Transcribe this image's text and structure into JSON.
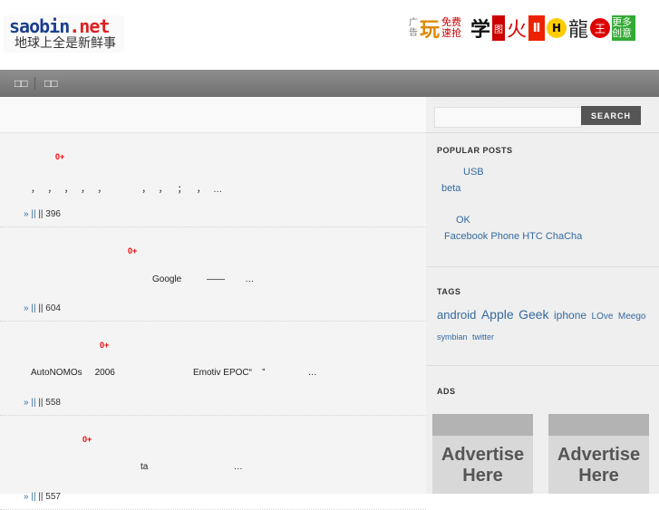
{
  "logo": {
    "brand": "saobin",
    "tld": ".net",
    "tagline": "地球上全是新鲜事"
  },
  "ad_strip": {
    "tag": "广告",
    "cells": [
      "玩",
      "免费速抢",
      "学",
      "图",
      "火",
      "Ⅱ",
      "H",
      "龍",
      "王",
      "更多创意"
    ]
  },
  "nav": {
    "items": [
      "",
      ""
    ]
  },
  "posts": [
    {
      "count": "0+",
      "excerpt": "，   ，   ，   ，   ，              ，   ，    ；    ，   …",
      "views": "|| 396"
    },
    {
      "count": "0+",
      "excerpt": "Google          ——        …",
      "views": "|| 604"
    },
    {
      "count": "0+",
      "excerpt": "AutoNOMOs     2006                               Emotiv EPOC“    ”                 …",
      "views": "|| 558"
    },
    {
      "count": "0+",
      "excerpt": "ta                                  …",
      "views": "|| 557"
    }
  ],
  "post_meta_prefix": "» ||",
  "sidebar": {
    "search_placeholder": "",
    "search_button": "SEARCH",
    "popular_title": "POPULAR POSTS",
    "popular": [
      "USB",
      "beta",
      "OK",
      "Facebook Phone HTC ChaCha"
    ],
    "tags_title": "TAGS",
    "tags": [
      {
        "label": "android",
        "size": 13
      },
      {
        "label": "Apple",
        "size": 14
      },
      {
        "label": "Geek",
        "size": 14
      },
      {
        "label": "iphone",
        "size": 12
      },
      {
        "label": "LOve",
        "size": 10
      },
      {
        "label": "Meego",
        "size": 10
      },
      {
        "label": "symbian",
        "size": 9
      },
      {
        "label": "twitter",
        "size": 9
      }
    ],
    "ads_title": "ADS",
    "ad_boxes": [
      "Advertise Here",
      "Advertise Here"
    ]
  },
  "colors": {
    "nav_bar": "#7f7f7f",
    "link": "#356aa0",
    "count": "#e00000",
    "search_button": "#555555"
  }
}
